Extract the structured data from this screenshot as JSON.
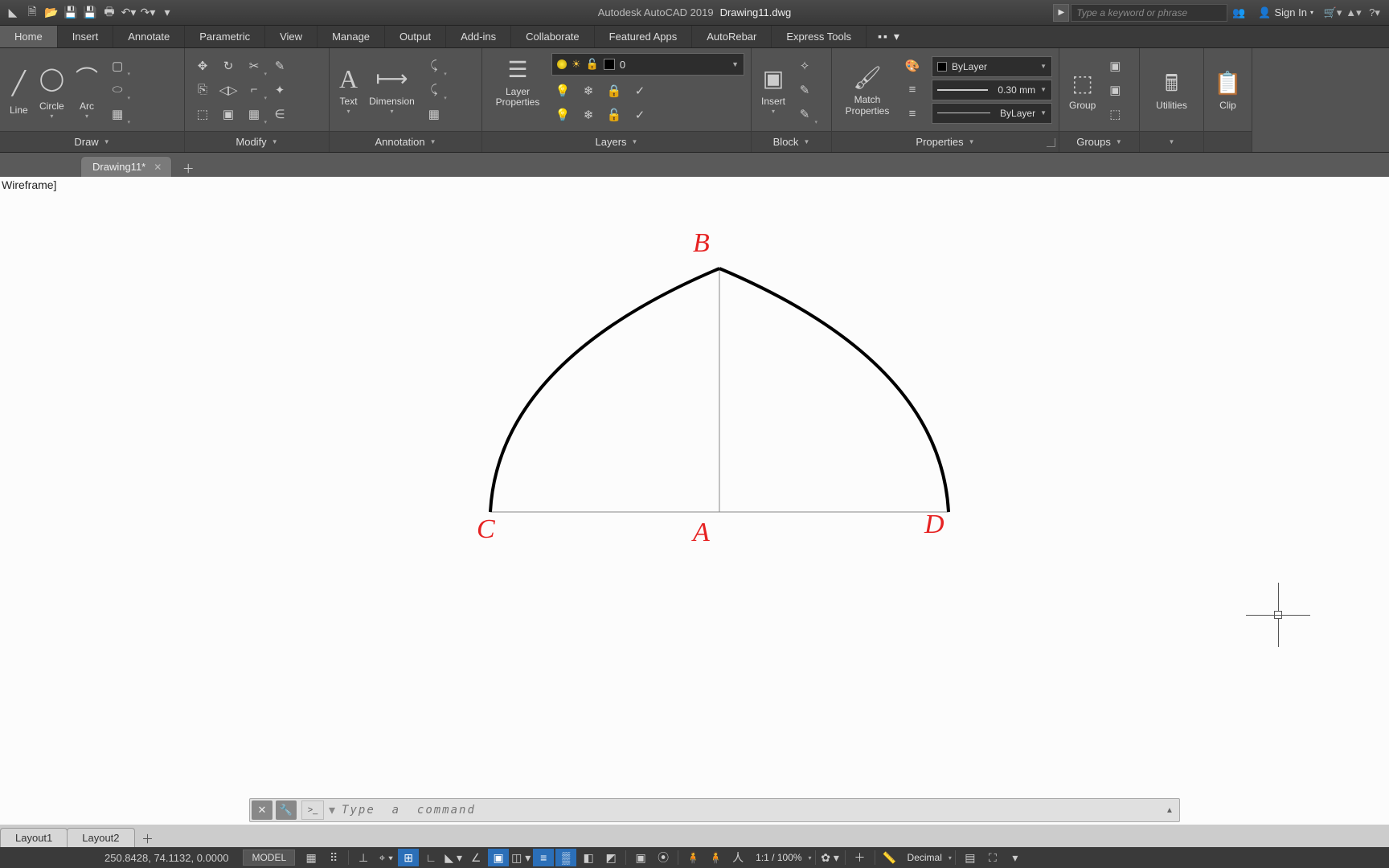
{
  "title": {
    "app": "Autodesk AutoCAD 2019",
    "file": "Drawing11.dwg"
  },
  "search_placeholder": "Type a keyword or phrase",
  "signin": "Sign In",
  "menu": [
    "Home",
    "Insert",
    "Annotate",
    "Parametric",
    "View",
    "Manage",
    "Output",
    "Add-ins",
    "Collaborate",
    "Featured Apps",
    "AutoRebar",
    "Express Tools"
  ],
  "active_menu": 0,
  "panels": {
    "draw": {
      "title": "Draw",
      "items": [
        "Line",
        "Circle",
        "Arc"
      ]
    },
    "modify": {
      "title": "Modify"
    },
    "annotation": {
      "title": "Annotation",
      "items": [
        "Text",
        "Dimension"
      ]
    },
    "layers": {
      "title": "Layers",
      "btn": "Layer\nProperties",
      "current": "0"
    },
    "block": {
      "title": "Block",
      "btn": "Insert"
    },
    "properties": {
      "title": "Properties",
      "btn": "Match\nProperties",
      "color": "ByLayer",
      "lineweight": "0.30 mm",
      "linetype": "ByLayer"
    },
    "groups": {
      "title": "Groups",
      "btn": "Group"
    },
    "utilities": {
      "title": "Utilities"
    },
    "clipboard": {
      "title": "Clip"
    }
  },
  "filetab": "Drawing11*",
  "viewport_label": "Wireframe]",
  "points": {
    "A": "A",
    "B": "B",
    "C": "C",
    "D": "D"
  },
  "command_placeholder": "Type  a  command",
  "layout_tabs": [
    "Layout1",
    "Layout2"
  ],
  "status": {
    "coords": "250.8428, 74.1132, 0.0000",
    "model": "MODEL",
    "scale": "1:1 / 100%",
    "units": "Decimal"
  }
}
